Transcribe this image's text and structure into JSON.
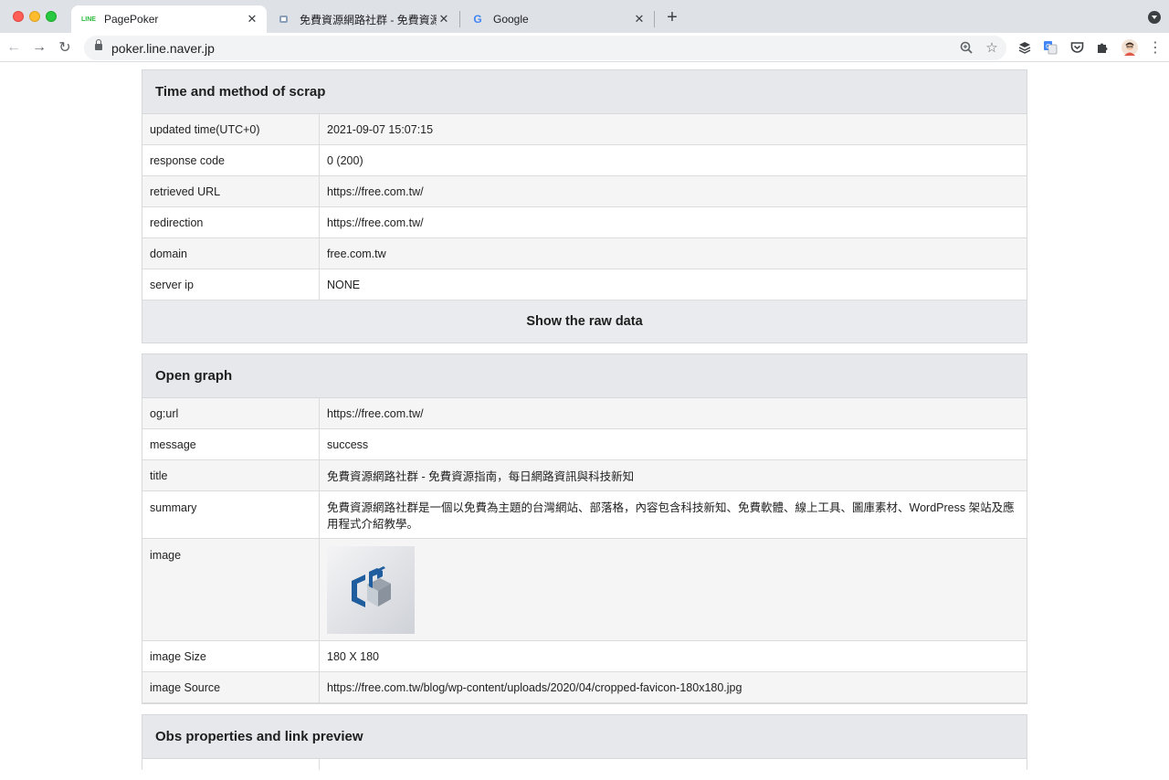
{
  "browser": {
    "tabs": [
      {
        "title": "PagePoker",
        "favicon": "LINE"
      },
      {
        "title": "免費資源網路社群 - 免費資源指南，每日網路資訊與科技新知"
      },
      {
        "title": "Google",
        "favicon": "G"
      }
    ],
    "url": "poker.line.naver.jp"
  },
  "scrap": {
    "heading": "Time and method of scrap",
    "rows": [
      {
        "key": "updated time(UTC+0)",
        "value": "2021-09-07 15:07:15"
      },
      {
        "key": "response code",
        "value": "0 (200)"
      },
      {
        "key": "retrieved URL",
        "value": "https://free.com.tw/"
      },
      {
        "key": "redirection",
        "value": "https://free.com.tw/"
      },
      {
        "key": "domain",
        "value": "free.com.tw"
      },
      {
        "key": "server ip",
        "value": "NONE"
      }
    ],
    "raw_button": "Show the raw data"
  },
  "og": {
    "heading": "Open graph",
    "rows": [
      {
        "key": "og:url",
        "value": "https://free.com.tw/"
      },
      {
        "key": "message",
        "value": "success"
      },
      {
        "key": "title",
        "value": "免費資源網路社群 - 免費資源指南，每日網路資訊與科技新知"
      },
      {
        "key": "summary",
        "value": "免費資源網路社群是一個以免費為主題的台灣網站、部落格，內容包含科技新知、免費軟體、線上工具、圖庫素材、WordPress 架站及應用程式介紹教學。"
      },
      {
        "key": "image",
        "value": ""
      },
      {
        "key": "image Size",
        "value": "180 X 180"
      },
      {
        "key": "image Source",
        "value": "https://free.com.tw/blog/wp-content/uploads/2020/04/cropped-favicon-180x180.jpg"
      }
    ]
  },
  "obs": {
    "heading": "Obs properties and link preview"
  }
}
